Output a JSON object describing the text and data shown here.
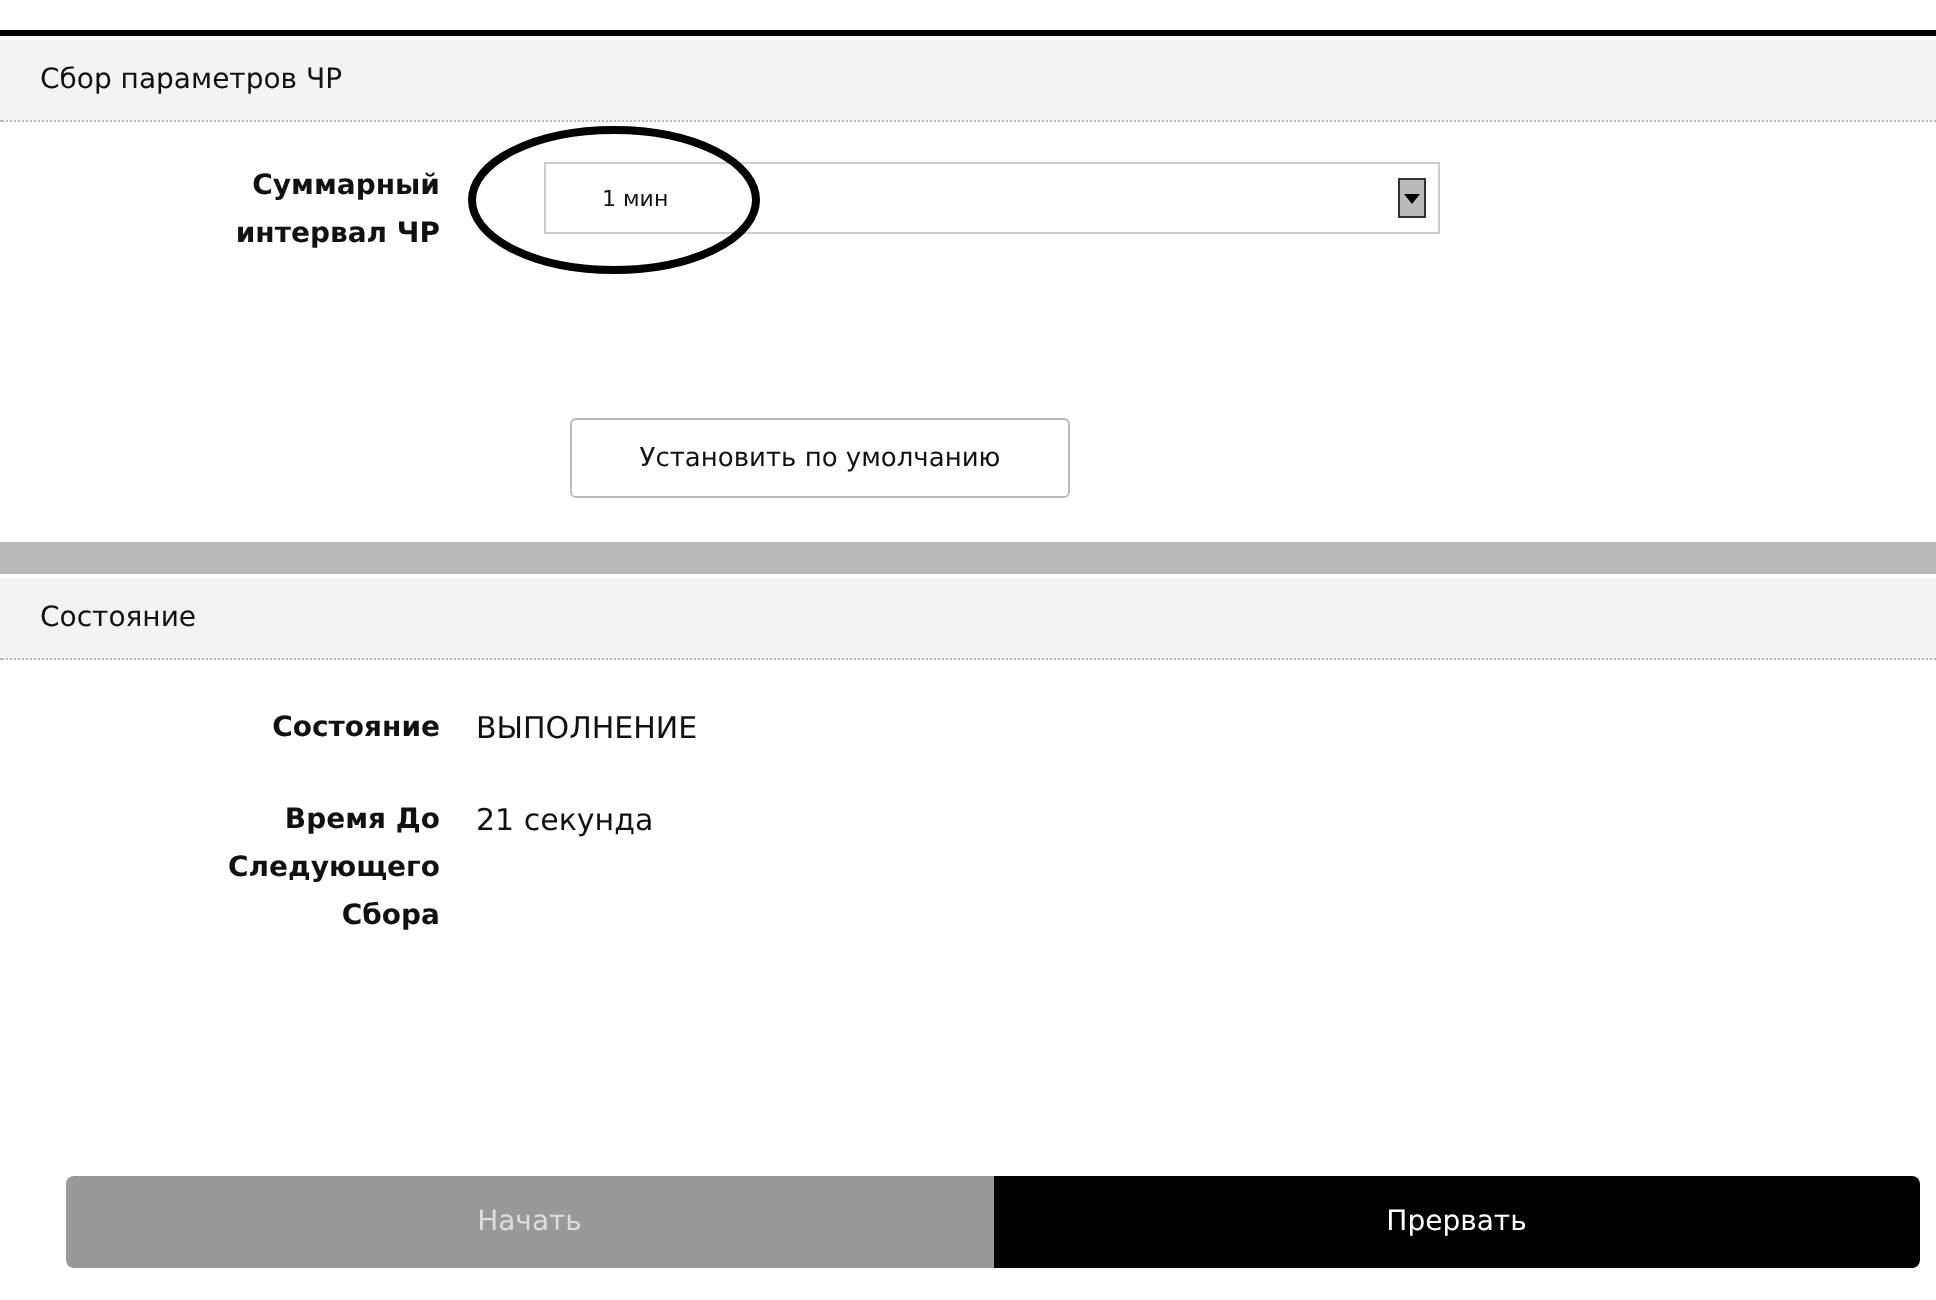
{
  "params_section": {
    "title": "Сбор параметров ЧР",
    "field_label": "Суммарный интервал ЧР",
    "select_value": "1 мин",
    "default_button": "Установить по умолчанию"
  },
  "status_section": {
    "title": "Состояние",
    "rows": [
      {
        "label": "Состояние",
        "value": "ВЫПОЛНЕНИЕ"
      },
      {
        "label": "Время До Следующего Сбора",
        "value": "21 секунда"
      }
    ]
  },
  "buttons": [
    {
      "label": "Начать",
      "disabled": true
    },
    {
      "label": "Прервать",
      "disabled": false
    }
  ]
}
